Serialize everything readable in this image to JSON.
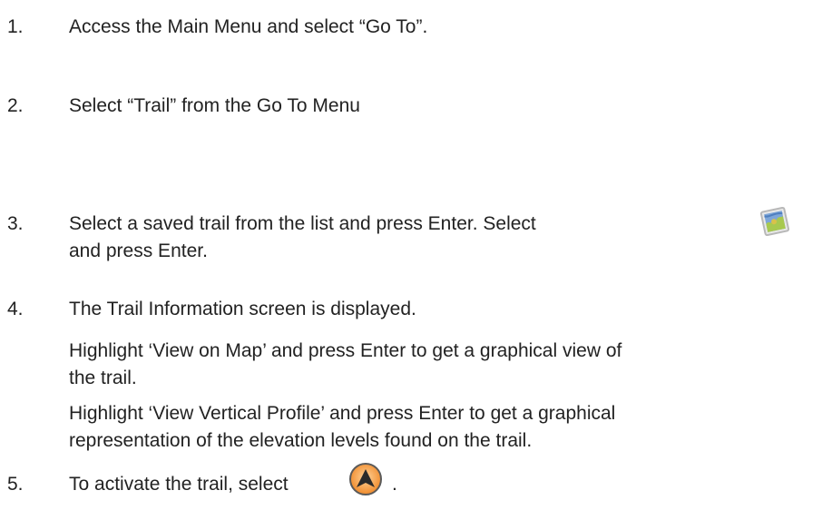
{
  "steps": [
    {
      "number": "1.",
      "text": "Access the Main Menu and select “Go To”."
    },
    {
      "number": "2.",
      "text": "Select “Trail” from the Go To Menu"
    },
    {
      "number": "3.",
      "line1": "Select a saved trail from the list and press Enter. Select",
      "line2": "and press Enter.",
      "icon": "map-view-icon"
    },
    {
      "number": "4.",
      "text": "The Trail Information screen is displayed.",
      "para1_line1": "Highlight ‘View on Map’ and press Enter to get a graphical view of",
      "para1_line2": "the trail.",
      "para2_line1": "Highlight ‘View Vertical Profile’ and press Enter to get a graphical",
      "para2_line2": "representation of the elevation levels found on the trail."
    },
    {
      "number": "5.",
      "text": "To activate the trail, select",
      "suffix": ".",
      "icon": "navigate-arrow-icon"
    }
  ],
  "colors": {
    "text": "#222222",
    "nav_icon_ring": "#4a4a4a",
    "nav_icon_fill": "#f3a54a",
    "map_icon_frame": "#c9c9c9",
    "map_icon_water": "#5d8cc9",
    "map_icon_land": "#a8c94f"
  }
}
